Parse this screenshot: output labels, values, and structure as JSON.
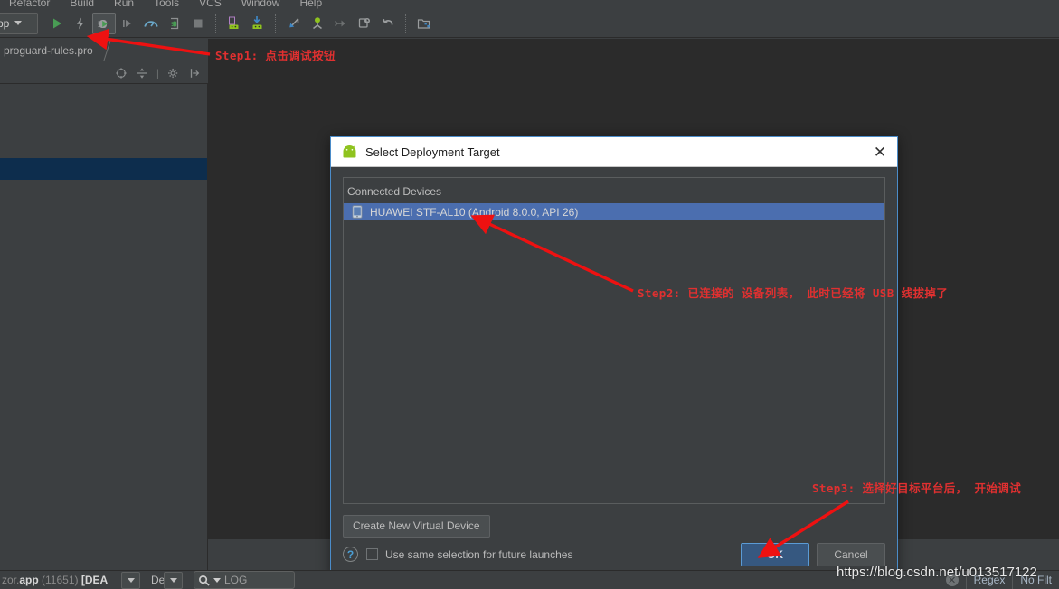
{
  "menubar": {
    "items": [
      {
        "label": "Refactor"
      },
      {
        "label": "Build"
      },
      {
        "label": "Run"
      },
      {
        "label": "Tools"
      },
      {
        "label": "VCS"
      },
      {
        "label": "Window"
      },
      {
        "label": "Help"
      }
    ]
  },
  "toolbar": {
    "run_config_label": "pp",
    "buttons": [
      {
        "name": "run-button",
        "icon": "play-icon"
      },
      {
        "name": "apply-changes-button",
        "icon": "lightning-icon"
      },
      {
        "name": "debug-button",
        "icon": "bug-debug-icon"
      },
      {
        "name": "step-over-button",
        "icon": "step-icon"
      },
      {
        "name": "profile-button",
        "icon": "gauge-icon"
      },
      {
        "name": "attach-debugger-button",
        "icon": "attach-process-icon"
      },
      {
        "name": "stop-button",
        "icon": "stop-square-icon"
      },
      {
        "name": "sdk-manager-button",
        "icon": "android-sdk-icon"
      },
      {
        "name": "avd-manager-button",
        "icon": "android-avd-icon"
      },
      {
        "name": "update-project-button",
        "icon": "vcs-update-icon"
      },
      {
        "name": "commit-button",
        "icon": "vcs-commit-icon"
      },
      {
        "name": "push-button",
        "icon": "vcs-push-icon"
      },
      {
        "name": "history-button",
        "icon": "vcs-history-icon"
      },
      {
        "name": "revert-button",
        "icon": "vcs-revert-icon"
      },
      {
        "name": "project-structure-button",
        "icon": "project-structure-icon"
      }
    ]
  },
  "editor": {
    "tab_label": "proguard-rules.pro"
  },
  "dialog": {
    "title": "Select Deployment Target",
    "close_label": "✕",
    "group_label": "Connected Devices",
    "devices": [
      {
        "label": "HUAWEI STF-AL10 (Android 8.0.0, API 26)",
        "icon": "phone-icon",
        "selected": true
      }
    ],
    "create_device_label": "Create New Virtual Device",
    "help_label": "?",
    "checkbox": {
      "label": "Use same selection for future launches",
      "checked": false
    },
    "ok_label": "OK",
    "cancel_label": "Cancel"
  },
  "statusbar": {
    "process_prefix": "zor.",
    "process_app": "app",
    "process_pid": "(11651)",
    "process_state": "[DEA",
    "debug_label": "Debug",
    "search_placeholder": "LOG",
    "regex_label": "Regex",
    "filter_label": "No Filt"
  },
  "annotations": {
    "step1": "Step1:  点击调试按钮",
    "step2": "Step2:  已连接的 设备列表， 此时已经将 USB 线拔掉了",
    "step3": "Step3:  选择好目标平台后， 开始调试",
    "color": "#e03030"
  },
  "watermark": {
    "text": "https://blog.csdn.net/u013517122"
  },
  "colors": {
    "ide_bg": "#3c3f41",
    "editor_bg": "#2b2b2b",
    "selection_blue": "#4b6eaf",
    "dialog_border": "#4b8cc9",
    "ok_button": "#365880",
    "annotation_red": "#e03030"
  }
}
